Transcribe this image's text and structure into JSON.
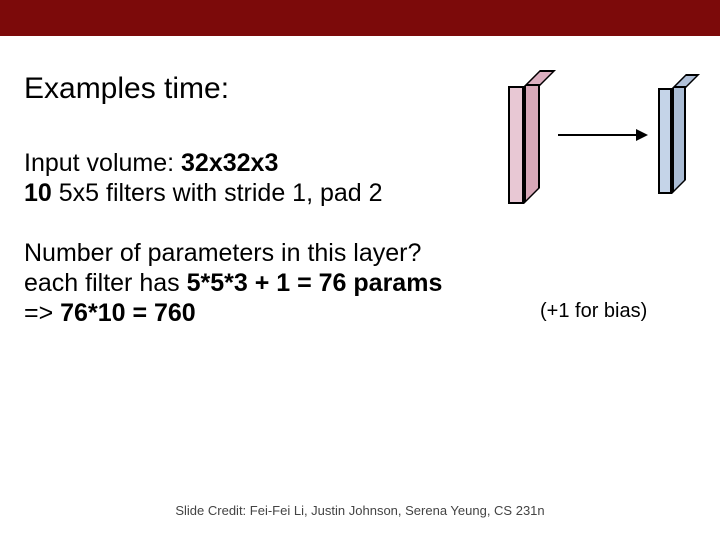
{
  "title": "Examples time:",
  "input": {
    "prefix": "Input volume: ",
    "dims": "32x32x3"
  },
  "filters": {
    "count": "10",
    "desc": " 5x5 filters with stride 1, pad 2"
  },
  "question": "Number of parameters in this layer?",
  "answer_line1_a": "each filter has ",
  "answer_line1_b": "5*5*3 + 1 = 76 params",
  "answer_line2_a": "=> ",
  "answer_line2_b": "76*10 = ",
  "answer_line2_c": "760",
  "bias_note": "(+1 for bias)",
  "footer": "Slide Credit: Fei-Fei Li, Justin Johnson, Serena Yeung, CS 231n"
}
